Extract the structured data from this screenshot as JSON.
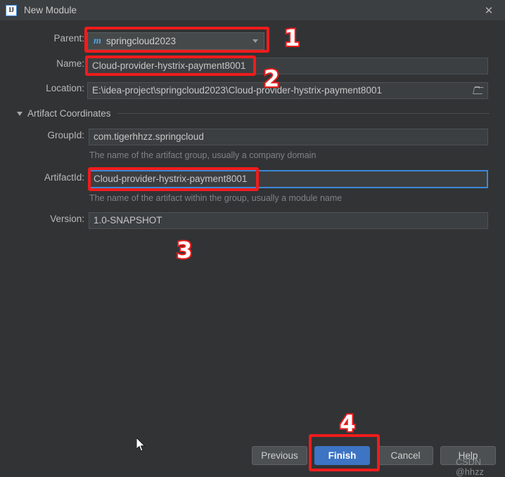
{
  "window": {
    "title": "New Module",
    "logo_text": "IJ",
    "close_label": "✕"
  },
  "form": {
    "parent": {
      "label": "Parent:",
      "icon": "maven-m-icon",
      "value": "springcloud2023"
    },
    "name": {
      "label": "Name:",
      "value": "Cloud-provider-hystrix-payment8001"
    },
    "location": {
      "label": "Location:",
      "value": "E:\\idea-project\\springcloud2023\\Cloud-provider-hystrix-payment8001",
      "browse_icon": "folder-icon"
    },
    "section": {
      "title": "Artifact Coordinates",
      "collapse_icon": "triangle-down-icon"
    },
    "group_id": {
      "label": "GroupId:",
      "value": "com.tigerhhzz.springcloud",
      "hint": "The name of the artifact group, usually a company domain"
    },
    "artifact_id": {
      "label": "ArtifactId:",
      "value": "Cloud-provider-hystrix-payment8001",
      "hint": "The name of the artifact within the group, usually a module name"
    },
    "version": {
      "label": "Version:",
      "value": "1.0-SNAPSHOT"
    }
  },
  "buttons": {
    "previous": "Previous",
    "finish": "Finish",
    "cancel": "Cancel",
    "help": "Help"
  },
  "annotations": {
    "markers": [
      "1",
      "2",
      "3",
      "4"
    ]
  },
  "watermark": {
    "text": "CSDN @hhzz"
  },
  "colors": {
    "background": "#313335",
    "titlebar": "#3c3f41",
    "field_bg": "#3c3f41",
    "accent_blue": "#3d74c4",
    "focus_blue": "#3c88d8",
    "annotation_red": "#f01c1c",
    "maven_icon_blue": "#4ea6e0"
  }
}
